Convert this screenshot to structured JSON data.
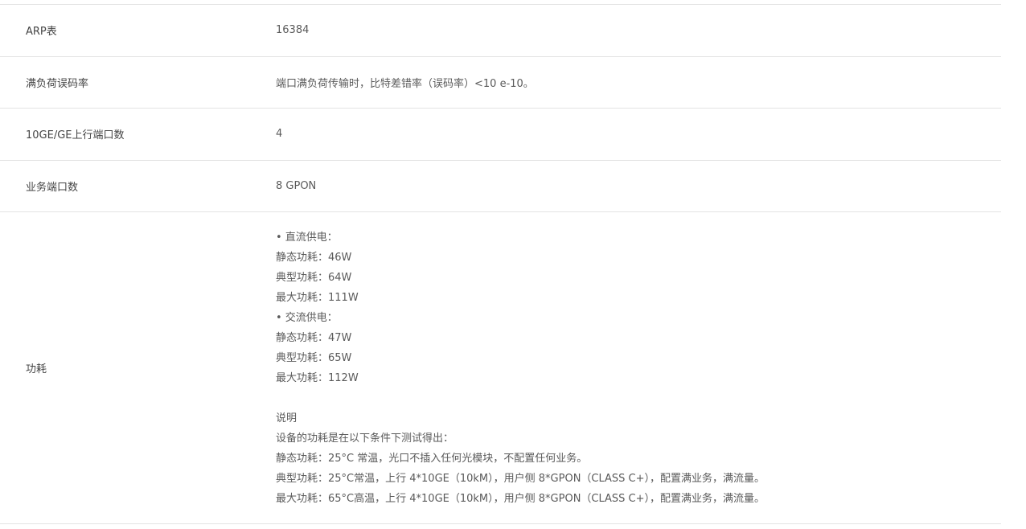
{
  "rows": [
    {
      "label": "ARP表",
      "value": "16384"
    },
    {
      "label": "满负荷误码率",
      "value": "端口满负荷传输时，比特差错率（误码率）<10 e-10。"
    },
    {
      "label": "10GE/GE上行端口数",
      "value": "4"
    },
    {
      "label": "业务端口数",
      "value": "8 GPON"
    },
    {
      "label": "功耗",
      "dc": {
        "heading": "• 直流供电：",
        "lines": [
          "静态功耗：46W",
          "典型功耗：64W",
          "最大功耗：111W"
        ]
      },
      "ac": {
        "heading": "• 交流供电：",
        "lines": [
          "静态功耗：47W",
          "典型功耗：65W",
          "最大功耗：112W"
        ]
      },
      "note": {
        "title": "说明",
        "lines": [
          "设备的功耗是在以下条件下测试得出：",
          "静态功耗：25°C 常温，光口不插入任何光模块，不配置任何业务。",
          "典型功耗：25°C常温，上行 4*10GE（10kM），用户侧 8*GPON（CLASS C+），配置满业务，满流量。",
          "最大功耗：65°C高温，上行 4*10GE（10kM），用户侧 8*GPON（CLASS C+），配置满业务，满流量。"
        ]
      }
    }
  ]
}
